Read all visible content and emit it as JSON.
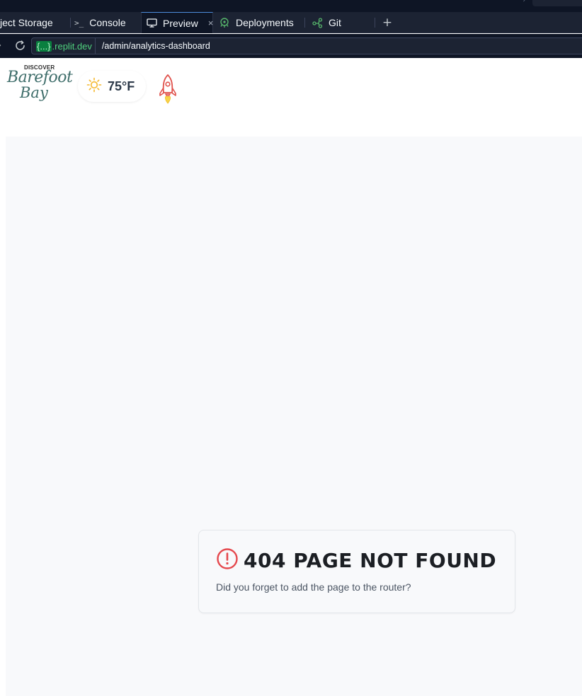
{
  "tabs": [
    {
      "label": "ject Storage",
      "icon": "object-storage-icon"
    },
    {
      "label": "Console",
      "icon": "console-icon"
    },
    {
      "label": "Preview",
      "icon": "monitor-icon",
      "active": true
    },
    {
      "label": "Deployments",
      "icon": "deployments-icon"
    },
    {
      "label": "Git",
      "icon": "git-icon"
    }
  ],
  "close_tab_glyph": "×",
  "add_tab_glyph": "+",
  "console_glyph": ">_",
  "url": {
    "domain_prefix": "{...}",
    "domain_suffix": ".replit.dev",
    "path": "/admin/analytics-dashboard"
  },
  "site": {
    "logo_small": "DISCOVER",
    "logo_line1": "Barefoot",
    "logo_line2": "Bay",
    "weather": {
      "icon": "sun-icon",
      "temperature": "75°F"
    },
    "rocket_icon": "rocket-icon"
  },
  "error": {
    "title": "404 PAGE NOT FOUND",
    "message": "Did you forget to add the page to the router?"
  },
  "colors": {
    "ide_dark": "#0e1525",
    "ide_panel": "#1c2333",
    "active_tab_border": "#4e8ddd",
    "domain_green": "#4fd17d",
    "error_red": "#e5484d",
    "sun_yellow": "#f5b82e",
    "page_bg": "#f8f9fb"
  }
}
